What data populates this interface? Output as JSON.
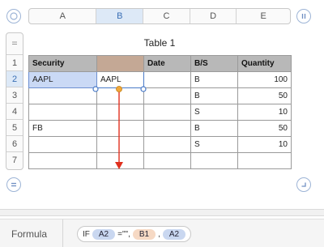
{
  "columns": [
    "A",
    "B",
    "C",
    "D",
    "E"
  ],
  "active_column": "B",
  "rows": [
    "1",
    "2",
    "3",
    "4",
    "5",
    "6",
    "7"
  ],
  "active_row": "2",
  "table_title": "Table 1",
  "table": {
    "headers": [
      "Security",
      "",
      "Date",
      "B/S",
      "Quantity"
    ],
    "body": [
      [
        "AAPL",
        "AAPL",
        "",
        "B",
        "100"
      ],
      [
        "",
        "",
        "",
        "B",
        "50"
      ],
      [
        "",
        "",
        "",
        "S",
        "10"
      ],
      [
        "FB",
        "",
        "",
        "B",
        "50"
      ],
      [
        "",
        "",
        "",
        "S",
        "10"
      ],
      [
        "",
        "",
        "",
        "",
        ""
      ]
    ]
  },
  "formula_bar": {
    "label": "Formula",
    "fn": "IF",
    "arg1": "A2",
    "op": "=\"\",",
    "arg2": "B1",
    "comma": ",",
    "arg3": "A2"
  },
  "colors": {
    "selection_blue": "#4a7bc8",
    "fill_handle_orange": "#f0a83a",
    "drag_arrow_red": "#e0301e",
    "header_gray": "#b8b8b8",
    "reference_b1": "#c4a895"
  },
  "icons": {
    "top_left": "circle-select-icon",
    "top_right": "pause-bars-icon",
    "row_grip": "grip-icon",
    "add_row": "equals-icon",
    "resize": "corner-resize-icon"
  }
}
